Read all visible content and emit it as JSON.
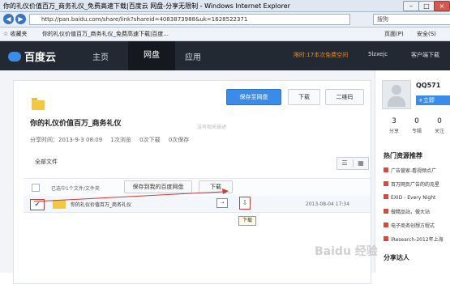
{
  "window": {
    "title": "你的礼仪价值百万_商务礼仪_免费高速下载|百度云 网盘-分享无限制 - Windows Internet Explorer",
    "minimize": "–",
    "maximize": "□",
    "close": "×"
  },
  "browser": {
    "back": "◀",
    "forward": "▶",
    "url": "http://pan.baidu.com/share/link?shareid=4083873988&uk=1628522371",
    "search_placeholder": "搜狗",
    "favorites_label": "☆ 收藏夹",
    "tab_title": "你的礼仪价值百万_商务礼仪_免费高速下载|百度...",
    "page_menu": "页面(P)",
    "safety_menu": "安全(S)"
  },
  "site_nav": {
    "logo": "百度云",
    "items": [
      "主页",
      "网盘",
      "应用"
    ],
    "active": "网盘",
    "promo": "限时:17本次免费空间",
    "user": "5lzxejc",
    "client": "客户端下载"
  },
  "share": {
    "title": "你的礼仪价值百万_商务礼仪",
    "time_label": "分享时间：2013-9-3 08:09",
    "views": "1次浏览",
    "downloads": "0次下载",
    "saves": "0次保存",
    "no_desc": "没有相关描述",
    "save_button": "保存至网盘",
    "download_button": "下载",
    "qrcode_button": "二维码"
  },
  "file_list": {
    "all_files": "全部文件",
    "selected": "已选中1个文件/文件夹",
    "save_to_my": "保存到我的百度网盘",
    "download": "下载",
    "view_list": "☰",
    "view_grid": "▦",
    "rows": [
      {
        "name": "你的礼仪价值百万_商务礼仪",
        "date": "2013-08-04 17:34",
        "checked": true
      }
    ],
    "tooltip": "下载"
  },
  "sidebar": {
    "user_name": "QQ571",
    "follow": "+立即",
    "stats": [
      {
        "count": "3",
        "label": "分享"
      },
      {
        "count": "0",
        "label": "专辑"
      },
      {
        "count": "0",
        "label": "关注"
      }
    ],
    "hot_title": "热门资源推荐",
    "hot_items": [
      "广告营家-看视频点广",
      "百万网页广告的的克星",
      "EXID - Every Night",
      "做精品站，做大站",
      "电子商务创想方程式",
      "iResearch-2012年上海"
    ],
    "share_people": "分享达人"
  },
  "watermark": "Baidu 经验",
  "colors": {
    "nav_bg": "#222933",
    "accent": "#3b8be8",
    "promo": "#e58b2b",
    "annotation": "#d23b32"
  }
}
